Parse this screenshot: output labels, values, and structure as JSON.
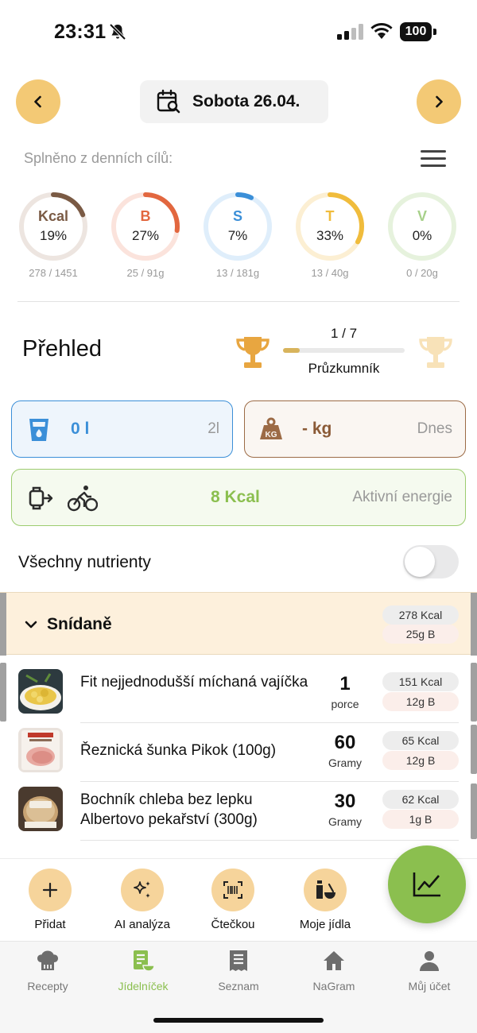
{
  "status_bar": {
    "time": "23:31",
    "battery": "100"
  },
  "date_nav": {
    "date": "Sobota 26.04."
  },
  "goals": {
    "subtitle": "Splněno z denních cílů:",
    "rings": [
      {
        "label": "Kcal",
        "percent": "19%",
        "sub": "278 / 1451",
        "fraction": 0.19,
        "color": "#7a5a44",
        "track": "#ede5e0",
        "label_color": "#7a5a44"
      },
      {
        "label": "B",
        "percent": "27%",
        "sub": "25 / 91g",
        "fraction": 0.27,
        "color": "#e2673f",
        "track": "#fbe3dc",
        "label_color": "#e2673f"
      },
      {
        "label": "S",
        "percent": "7%",
        "sub": "13 / 181g",
        "fraction": 0.07,
        "color": "#3b8fd8",
        "track": "#dfeefb",
        "label_color": "#3b8fd8"
      },
      {
        "label": "T",
        "percent": "33%",
        "sub": "13 / 40g",
        "fraction": 0.33,
        "color": "#f0bc3c",
        "track": "#fcefd3",
        "label_color": "#f0bc3c"
      },
      {
        "label": "V",
        "percent": "0%",
        "sub": "0 / 20g",
        "fraction": 0.0,
        "color": "#a7d08a",
        "track": "#e6f2dd",
        "label_color": "#a7d08a"
      }
    ]
  },
  "overview": {
    "title": "Přehled",
    "progress_count": "1 / 7",
    "progress_fraction": 0.14,
    "progress_label": "Průzkumník"
  },
  "cards": {
    "water_value": "0 l",
    "water_goal": "2l",
    "weight_value": "- kg",
    "weight_when": "Dnes",
    "energy_value": "8 Kcal",
    "energy_label": "Aktivní energie"
  },
  "toggle": {
    "label": "Všechny nutrienty",
    "on": false
  },
  "meal": {
    "title": "Snídaně",
    "kcal": "278 Kcal",
    "protein": "25g B",
    "items": [
      {
        "name": "Fit nejjednodušší míchaná vajíčka",
        "qty": "1",
        "unit": "porce",
        "kcal": "151 Kcal",
        "protein": "12g B"
      },
      {
        "name": "Řeznická šunka Pikok (100g)",
        "qty": "60",
        "unit": "Gramy",
        "kcal": "65 Kcal",
        "protein": "12g B"
      },
      {
        "name": "Bochník chleba bez lepku Albertovo pekařství (300g)",
        "qty": "30",
        "unit": "Gramy",
        "kcal": "62 Kcal",
        "protein": "1g B"
      }
    ]
  },
  "actions": [
    {
      "label": "Přidat",
      "icon": "plus-icon"
    },
    {
      "label": "AI analýza",
      "icon": "sparkles-icon"
    },
    {
      "label": "Čtečkou",
      "icon": "barcode-scan-icon"
    },
    {
      "label": "Moje jídla",
      "icon": "bottle-bowl-icon"
    }
  ],
  "tabs": [
    {
      "label": "Recepty",
      "icon": "chef-hat-icon",
      "active": false
    },
    {
      "label": "Jídelníček",
      "icon": "meal-plan-icon",
      "active": true
    },
    {
      "label": "Seznam",
      "icon": "receipt-list-icon",
      "active": false
    },
    {
      "label": "NaGram",
      "icon": "home-icon",
      "active": false
    },
    {
      "label": "Můj účet",
      "icon": "person-icon",
      "active": false
    }
  ],
  "colors": {
    "accent_yellow": "#f3c975",
    "accent_green": "#8bbf4f",
    "water_blue": "#3b8fd8",
    "weight_brown": "#9c6b46"
  }
}
